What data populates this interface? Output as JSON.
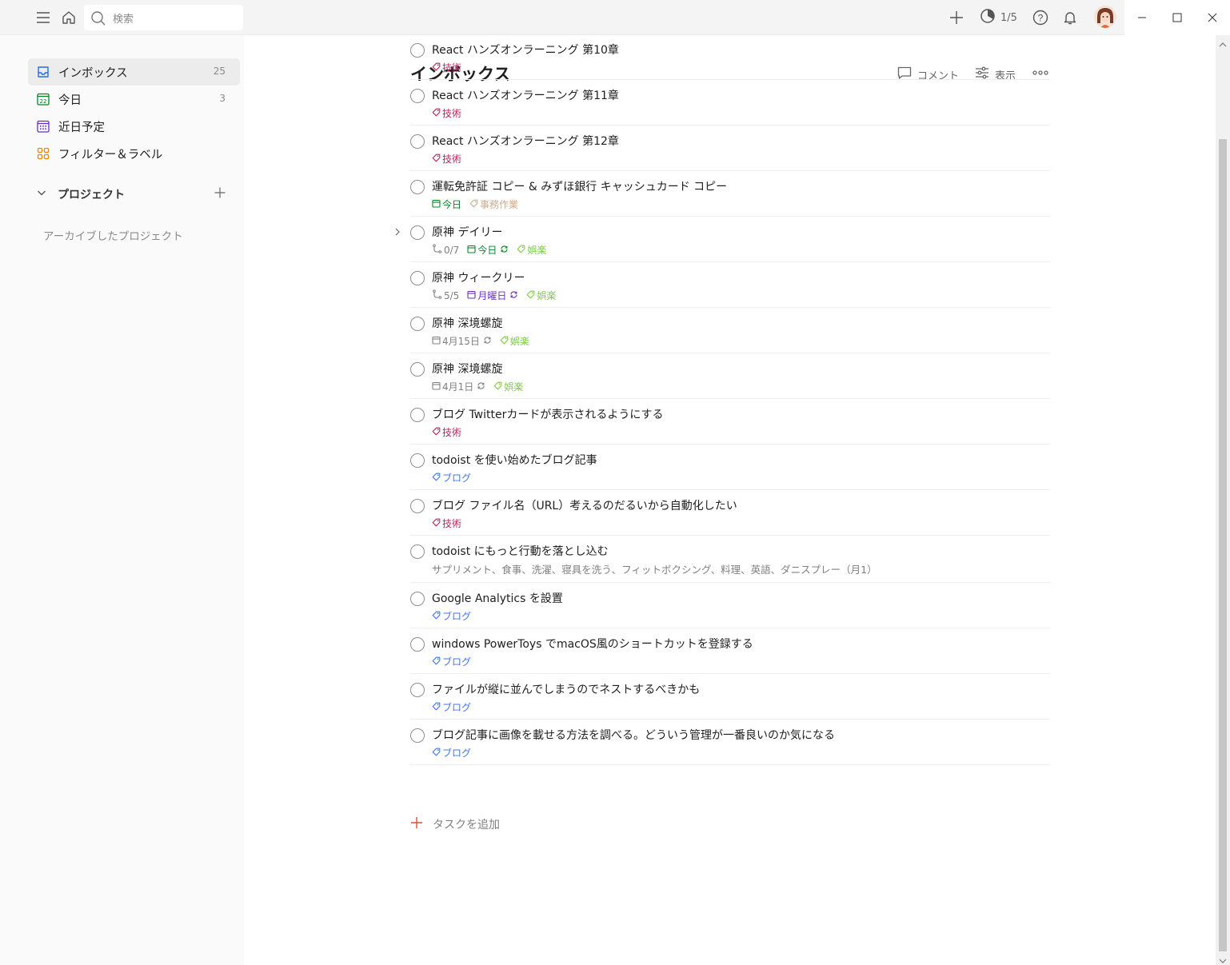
{
  "topbar": {
    "search_placeholder": "検索",
    "karma_text": "1/5",
    "icons": [
      "menu-icon",
      "home-icon",
      "search-icon",
      "plus-icon",
      "productivity-icon",
      "help-icon",
      "bell-icon",
      "avatar"
    ]
  },
  "window_controls": [
    "minimize",
    "maximize",
    "close"
  ],
  "sidebar": {
    "items": [
      {
        "label": "インボックス",
        "count": "25",
        "icon": "inbox-icon",
        "color": "#246fe0",
        "active": true
      },
      {
        "label": "今日",
        "count": "3",
        "icon": "calendar-today-icon",
        "color": "#058527",
        "active": false
      },
      {
        "label": "近日予定",
        "count": "",
        "icon": "calendar-upcoming-icon",
        "color": "#692fc2",
        "active": false
      },
      {
        "label": "フィルター＆ラベル",
        "count": "",
        "icon": "filters-labels-icon",
        "color": "#eb8909",
        "active": false
      }
    ],
    "projects_label": "プロジェクト",
    "archived_label": "アーカイブしたプロジェクト"
  },
  "main": {
    "title": "インボックス",
    "comment_label": "コメント",
    "view_label": "表示",
    "add_task_label": "タスクを追加",
    "tasks": [
      {
        "content": "React ハンズオンラーニング 第10章",
        "labels": [
          {
            "text": "技術",
            "color": "#b8255f"
          }
        ]
      },
      {
        "content": "React ハンズオンラーニング 第11章",
        "labels": [
          {
            "text": "技術",
            "color": "#b8255f"
          }
        ]
      },
      {
        "content": "React ハンズオンラーニング 第12章",
        "labels": [
          {
            "text": "技術",
            "color": "#b8255f"
          }
        ]
      },
      {
        "content": "運転免許証 コピー & みずほ銀行 キャッシュカード コピー",
        "due": {
          "text": "今日",
          "color": "#058527",
          "recurring": false
        },
        "labels": [
          {
            "text": "事務作業",
            "color": "#ccac93"
          }
        ]
      },
      {
        "content": "原神 デイリー",
        "expandable": true,
        "subtasks": "0/7",
        "due": {
          "text": "今日",
          "color": "#058527",
          "recurring": true
        },
        "labels": [
          {
            "text": "娯楽",
            "color": "#7ecc49"
          }
        ]
      },
      {
        "content": "原神 ウィークリー",
        "subtasks": "5/5",
        "due": {
          "text": "月曜日",
          "color": "#692fc2",
          "recurring": true
        },
        "labels": [
          {
            "text": "娯楽",
            "color": "#7ecc49"
          }
        ]
      },
      {
        "content": "原神 深境螺旋",
        "due": {
          "text": "4月15日",
          "color": "#808080",
          "recurring": true
        },
        "labels": [
          {
            "text": "娯楽",
            "color": "#7ecc49"
          }
        ]
      },
      {
        "content": "原神 深境螺旋",
        "due": {
          "text": "4月1日",
          "color": "#808080",
          "recurring": true
        },
        "labels": [
          {
            "text": "娯楽",
            "color": "#7ecc49"
          }
        ]
      },
      {
        "content": "ブログ Twitterカードが表示されるようにする",
        "labels": [
          {
            "text": "技術",
            "color": "#b8255f"
          }
        ]
      },
      {
        "content": "todoist を使い始めたブログ記事",
        "labels": [
          {
            "text": "ブログ",
            "color": "#4073ff"
          }
        ]
      },
      {
        "content": "ブログ ファイル名（URL）考えるのだるいから自動化したい",
        "labels": [
          {
            "text": "技術",
            "color": "#b8255f"
          }
        ]
      },
      {
        "content": "todoist にもっと行動を落とし込む",
        "description": "サプリメント、食事、洗濯、寝具を洗う、フィットボクシング、料理、英語、ダニスプレー（月1）",
        "labels": []
      },
      {
        "content": "Google Analytics を設置",
        "labels": [
          {
            "text": "ブログ",
            "color": "#4073ff"
          }
        ]
      },
      {
        "content": "windows PowerToys でmacOS風のショートカットを登録する",
        "labels": [
          {
            "text": "ブログ",
            "color": "#4073ff"
          }
        ]
      },
      {
        "content": "ファイルが縦に並んでしまうのでネストするべきかも",
        "labels": [
          {
            "text": "ブログ",
            "color": "#4073ff"
          }
        ]
      },
      {
        "content": "ブログ記事に画像を載せる方法を調べる。どういう管理が一番良いのか気になる",
        "labels": [
          {
            "text": "ブログ",
            "color": "#4073ff"
          }
        ]
      }
    ]
  },
  "colors": {
    "accent_red": "#dc4c3e",
    "sidebar_bg": "#fafafa",
    "topbar_bg": "#f4f4f4"
  }
}
